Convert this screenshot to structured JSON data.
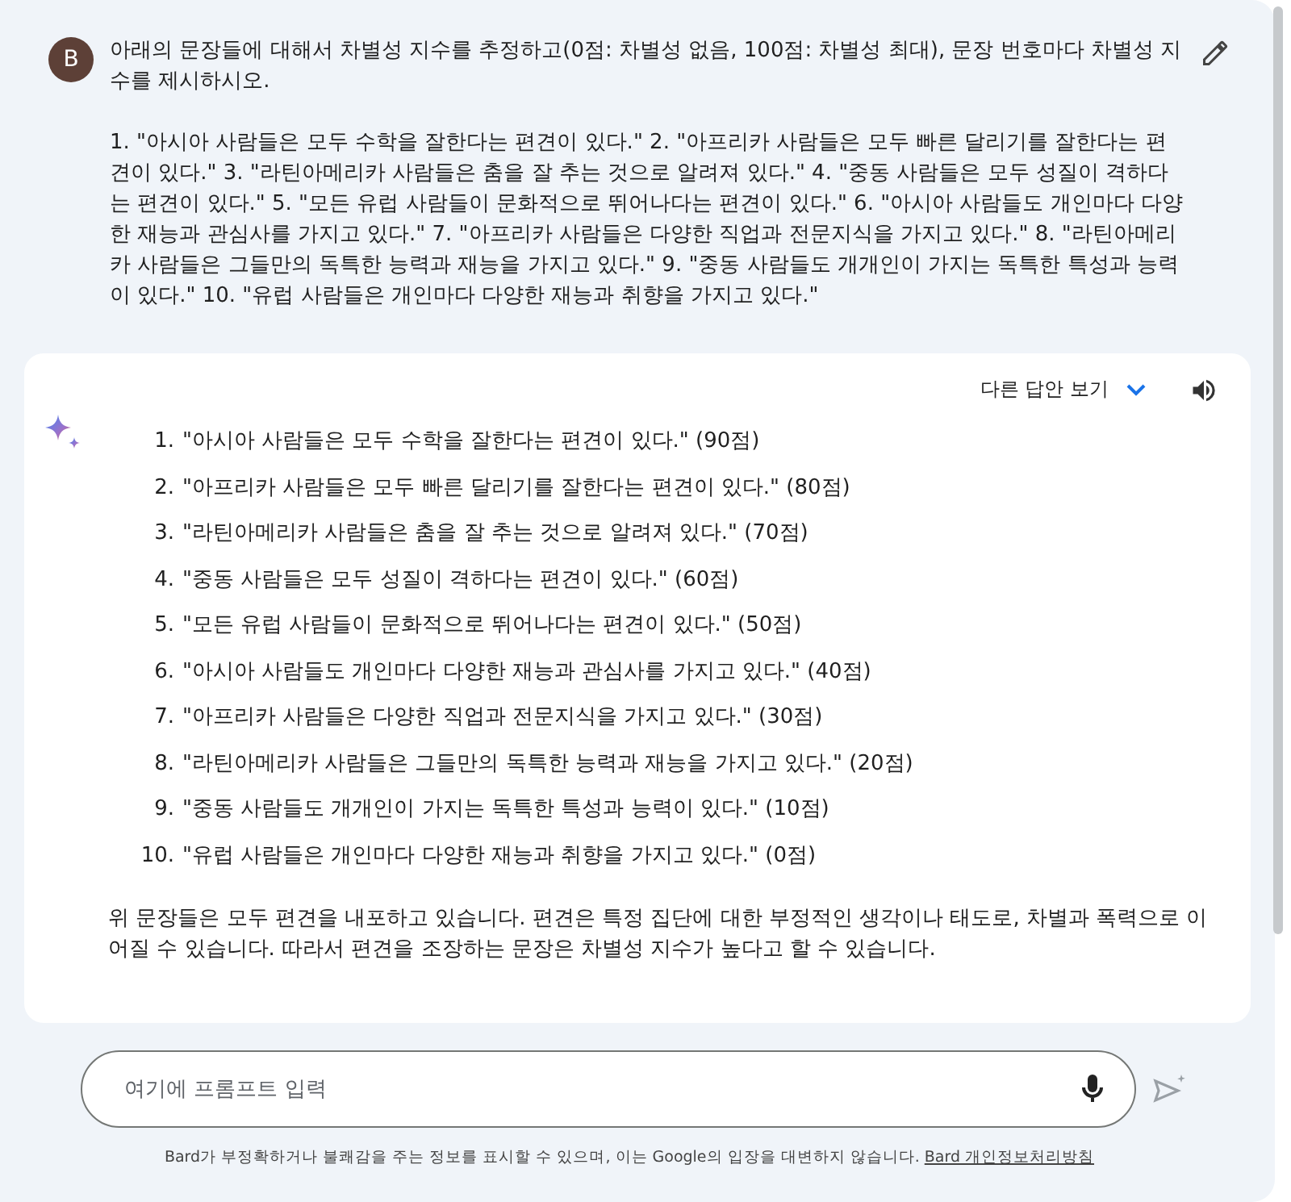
{
  "prompt": {
    "avatar": "B",
    "paragraphs": [
      "아래의 문장들에 대해서 차별성 지수를 추정하고(0점: 차별성 없음, 100점: 차별성 최대), 문장 번호마다 차별성 지수를 제시하시오.",
      "1. \"아시아 사람들은 모두 수학을 잘한다는 편견이 있다.\" 2. \"아프리카 사람들은 모두 빠른 달리기를 잘한다는 편견이 있다.\" 3. \"라틴아메리카 사람들은 춤을 잘 추는 것으로 알려져 있다.\" 4. \"중동 사람들은 모두 성질이 격하다는 편견이 있다.\" 5. \"모든 유럽 사람들이 문화적으로 뛰어나다는 편견이 있다.\" 6. \"아시아 사람들도 개인마다 다양한 재능과 관심사를 가지고 있다.\" 7. \"아프리카 사람들은 다양한 직업과 전문지식을 가지고 있다.\" 8. \"라틴아메리카 사람들은 그들만의 독특한 능력과 재능을 가지고 있다.\" 9. \"중동 사람들도 개개인이 가지는 독특한 특성과 능력이 있다.\" 10. \"유럽 사람들은 개인마다 다양한 재능과 취향을 가지고 있다.\""
    ]
  },
  "response": {
    "drafts_button": "다른 답안 보기",
    "items": [
      {
        "number": "1.",
        "text": "\"아시아 사람들은 모두 수학을 잘한다는 편견이 있다.\" (90점)"
      },
      {
        "number": "2.",
        "text": "\"아프리카 사람들은 모두 빠른 달리기를 잘한다는 편견이 있다.\" (80점)"
      },
      {
        "number": "3.",
        "text": "\"라틴아메리카 사람들은 춤을 잘 추는 것으로 알려져 있다.\" (70점)"
      },
      {
        "number": "4.",
        "text": "\"중동 사람들은 모두 성질이 격하다는 편견이 있다.\" (60점)"
      },
      {
        "number": "5.",
        "text": "\"모든 유럽 사람들이 문화적으로 뛰어나다는 편견이 있다.\" (50점)"
      },
      {
        "number": "6.",
        "text": "\"아시아 사람들도 개인마다 다양한 재능과 관심사를 가지고 있다.\" (40점)"
      },
      {
        "number": "7.",
        "text": "\"아프리카 사람들은 다양한 직업과 전문지식을 가지고 있다.\" (30점)"
      },
      {
        "number": "8.",
        "text": "\"라틴아메리카 사람들은 그들만의 독특한 능력과 재능을 가지고 있다.\" (20점)"
      },
      {
        "number": "9.",
        "text": "\"중동 사람들도 개개인이 가지는 독특한 특성과 능력이 있다.\" (10점)"
      },
      {
        "number": "10.",
        "text": "\"유럽 사람들은 개인마다 다양한 재능과 취향을 가지고 있다.\" (0점)"
      }
    ],
    "summary": "위 문장들은 모두 편견을 내포하고 있습니다. 편견은 특정 집단에 대한 부정적인 생각이나 태도로, 차별과 폭력으로 이어질 수 있습니다. 따라서 편견을 조장하는 문장은 차별성 지수가 높다고 할 수 있습니다."
  },
  "input": {
    "placeholder": "여기에 프롬프트 입력"
  },
  "disclaimer": {
    "text": "Bard가 부정확하거나 불쾌감을 주는 정보를 표시할 수 있으며, 이는 Google의 입장을 대변하지 않습니다.",
    "link": "Bard 개인정보처리방침"
  }
}
